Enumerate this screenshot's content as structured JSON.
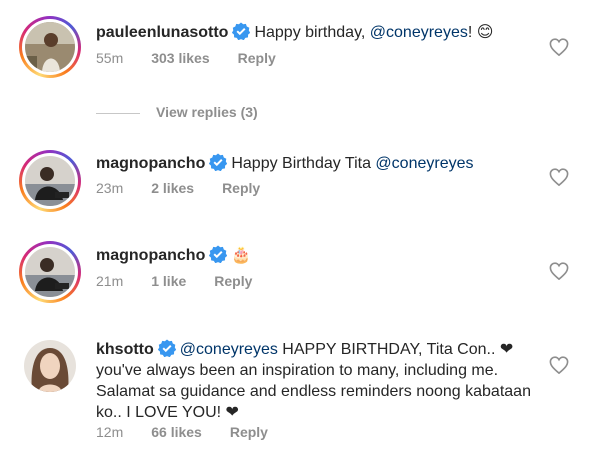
{
  "comments": [
    {
      "username": "pauleenlunasotto",
      "text": "Happy birthday, ",
      "mention": "@coneyreyes",
      "suffix": "! 😊",
      "time": "55m",
      "likes": "303 likes",
      "reply": "Reply"
    },
    {
      "username": "magnopancho",
      "text": "Happy Birthday Tita ",
      "mention": "@coneyreyes",
      "suffix": "",
      "time": "23m",
      "likes": "2 likes",
      "reply": "Reply"
    },
    {
      "username": "magnopancho",
      "text": "🎂",
      "mention": "",
      "suffix": "",
      "time": "21m",
      "likes": "1 like",
      "reply": "Reply"
    },
    {
      "username": "khsotto",
      "text": "",
      "mention": "@coneyreyes",
      "suffix": " HAPPY BIRTHDAY, Tita Con.. ❤ you've always been an inspiration to many, including me. Salamat sa guidance and endless reminders noong kabataan ko.. I LOVE YOU! ❤",
      "time": "12m",
      "likes": "66 likes",
      "reply": "Reply"
    }
  ],
  "view_replies": "View replies (3)",
  "colors": {
    "verified": "#3897f0",
    "mention": "#003569",
    "meta": "#8e8e8e"
  },
  "icons": {
    "verified": "verified-badge-icon",
    "like": "heart-outline-icon"
  }
}
